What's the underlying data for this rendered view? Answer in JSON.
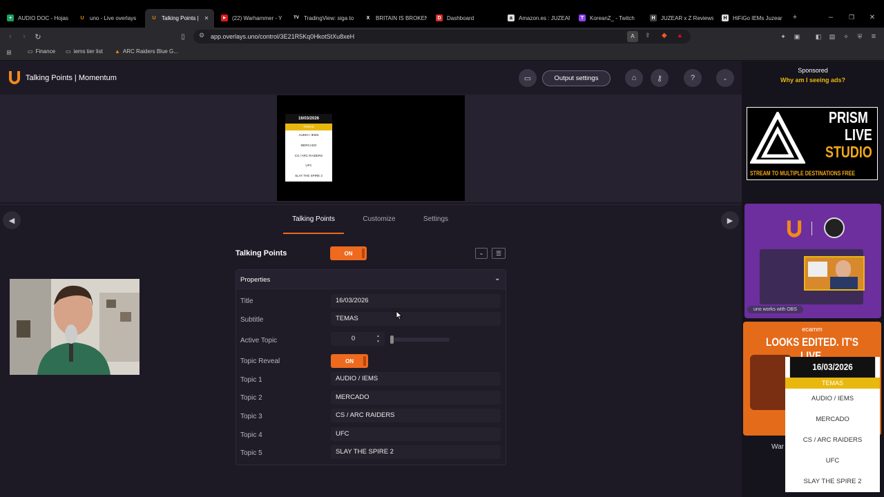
{
  "browser": {
    "tabs": [
      {
        "label": "AUDIO DOC - Hojas",
        "color": "#1aa260",
        "glyph": "+"
      },
      {
        "label": "uno - Live overlays",
        "color": "#e38b0a",
        "glyph": "U"
      },
      {
        "label": "Talking Points |",
        "color": "#e38b0a",
        "glyph": "U",
        "active": true
      },
      {
        "label": "(22) Warhammer - Y",
        "color": "#e01b1b",
        "glyph": "▶"
      },
      {
        "label": "TradingView: siga to",
        "color": "#333",
        "glyph": "TV"
      },
      {
        "label": "BRITAIN IS BROKEN",
        "color": "#222",
        "glyph": "X"
      },
      {
        "label": "Dashboard",
        "color": "#d32f2f",
        "glyph": "D"
      },
      {
        "label": "Amazon.es : JUZEAR",
        "color": "#ddd",
        "glyph": "a"
      },
      {
        "label": "KoreanZ_ - Twitch",
        "color": "#8e44ef",
        "glyph": "T"
      },
      {
        "label": "JUZEAR x Z Reviews",
        "color": "#444",
        "glyph": "H"
      },
      {
        "label": "HiFiGo IEMs Juzear",
        "color": "#ddd",
        "glyph": "H"
      }
    ],
    "url": "app.overlays.uno/control/3E21R5Kq0HkotStXu8xeH",
    "bookmarks": [
      "Finance",
      "iems tier list",
      "ARC Raiders Blue G..."
    ]
  },
  "app": {
    "title": "Talking Points | Momentum",
    "output_settings": "Output settings"
  },
  "preview": {
    "date": "16/03/2026",
    "header": "TEMAS",
    "items": [
      "AUDIO / IEMS",
      "MERCADO",
      "CS / ARC RAIDERS",
      "UFC",
      "SLAY THE SPIRE 2"
    ]
  },
  "tabs": [
    "Talking Points",
    "Customize",
    "Settings"
  ],
  "panel": {
    "heading": "Talking Points",
    "toggle": "ON",
    "properties_label": "Properties",
    "fields": {
      "title_label": "Title",
      "title_value": "16/03/2026",
      "subtitle_label": "Subtitle",
      "subtitle_value": "TEMAS",
      "active_topic_label": "Active Topic",
      "active_topic_value": "0",
      "topic_reveal_label": "Topic Reveal",
      "topic_reveal_value": "ON",
      "topic1_label": "Topic 1",
      "topic1_value": "AUDIO / IEMS",
      "topic2_label": "Topic 2",
      "topic2_value": "MERCADO",
      "topic3_label": "Topic 3",
      "topic3_value": "CS / ARC RAIDERS",
      "topic4_label": "Topic 4",
      "topic4_value": "UFC",
      "topic5_label": "Topic 5",
      "topic5_value": "SLAY THE SPIRE 2"
    }
  },
  "sidebar": {
    "sponsored": "Sponsored",
    "why_ads": "Why am I seeing ads?",
    "ad1": {
      "line1": "PRISM",
      "line2": "LIVE",
      "line3": "STUDIO",
      "line4": "STREAM TO MULTIPLE DESTINATIONS FREE"
    },
    "ad2_caption": "uno works with OBS",
    "ad3": {
      "brand": "ecamm",
      "headline": "LOOKS EDITED. IT'S LIVE."
    },
    "partial_text": "War"
  },
  "overlay": {
    "date": "16/03/2026",
    "header": "TEMAS",
    "items": [
      "AUDIO / IEMS",
      "MERCADO",
      "CS / ARC RAIDERS",
      "UFC",
      "SLAY THE SPIRE 2"
    ]
  },
  "colors": {
    "accent": "#ee6a1f",
    "gold": "#e8b80e",
    "purple": "#6d2e9e"
  }
}
